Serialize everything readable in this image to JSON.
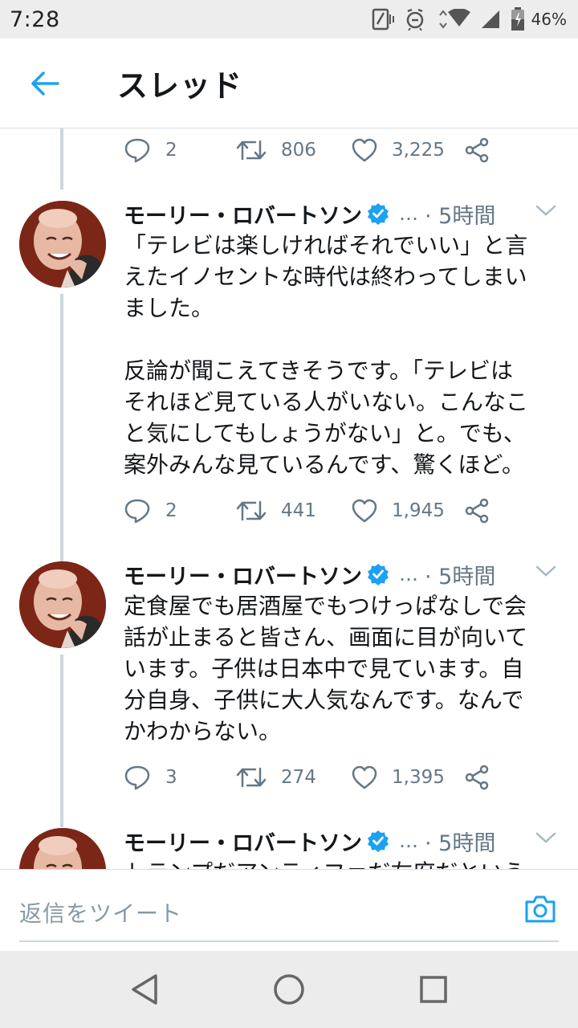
{
  "status": {
    "time": "7:28",
    "battery": "46%"
  },
  "header": {
    "title": "スレッド"
  },
  "top_actions": {
    "replies": "2",
    "retweets": "806",
    "likes": "3,225"
  },
  "tweets": [
    {
      "name": "モーリー・ロバートソン",
      "handle": "…",
      "time": "· 5時間",
      "text": "「テレビは楽しければそれでいい」と言\nえたイノセントな時代は終わってしまい\nました。\n\n反論が聞こえてきそうです。「テレビは\nそれほど見ている人がいない。こんなこ\nと気にしてもしょうがない」と。でも、\n案外みんな見ているんです、驚くほど。",
      "replies": "2",
      "retweets": "441",
      "likes": "1,945"
    },
    {
      "name": "モーリー・ロバートソン",
      "handle": "…",
      "time": "· 5時間",
      "text": "定食屋でも居酒屋でもつけっぱなしで会\n話が止まると皆さん、画面に目が向いて\nいます。子供は日本中で見ています。自\n分自身、子供に大人気なんです。なんで\nかわからない。",
      "replies": "3",
      "retweets": "274",
      "likes": "1,395"
    },
    {
      "name": "モーリー・ロバートソン",
      "handle": "…",
      "time": "· 5時間",
      "text": "トランプだアンティファだ左府だという"
    }
  ],
  "reply_bar": {
    "placeholder": "返信をツイート"
  },
  "colors": {
    "accent": "#1da1f2",
    "muted": "#657786",
    "divider": "#ccd6dd"
  },
  "icons": [
    "back-arrow-icon",
    "reply-icon",
    "retweet-icon",
    "like-icon",
    "share-icon",
    "verified-badge-icon",
    "caret-down-icon",
    "camera-icon",
    "nav-back-icon",
    "nav-home-icon",
    "nav-recents-icon"
  ]
}
